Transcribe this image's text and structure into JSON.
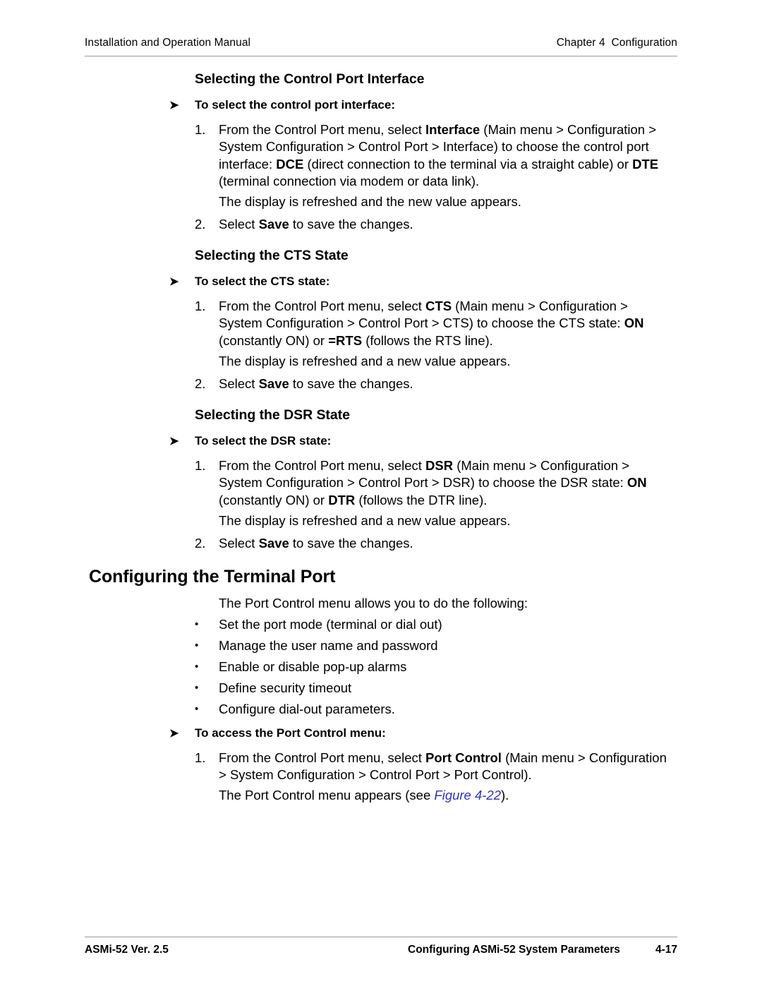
{
  "header": {
    "left": "Installation and Operation Manual",
    "right": "Chapter 4  Configuration"
  },
  "footer": {
    "left": "ASMi-52 Ver. 2.5",
    "center": "Configuring ASMi-52 System Parameters",
    "page": "4-17"
  },
  "icons": {
    "arrow_bullet": "➤",
    "round_bullet": "•"
  },
  "colors": {
    "text": "#000000",
    "rule": "#9a9a9a",
    "cross_reference": "#3333bb"
  },
  "sections": {
    "control_port_interface": {
      "heading": "Selecting the Control Port Interface",
      "procedure_title": "To select the control port interface:",
      "step1_num": "1.",
      "step1_a": "From the Control Port menu, select ",
      "step1_b": "Interface",
      "step1_c": " (Main menu > Configuration > System Configuration > Control Port > Interface) to choose the control port interface: ",
      "step1_d": "DCE",
      "step1_e": " (direct connection to the terminal via a straight cable) or ",
      "step1_f": "DTE",
      "step1_g": " (terminal connection via modem or data link).",
      "result": "The display is refreshed and the new value appears.",
      "step2_num": "2.",
      "step2_a": "Select ",
      "step2_b": "Save",
      "step2_c": " to save the changes."
    },
    "cts_state": {
      "heading": "Selecting the CTS State",
      "procedure_title": "To select the CTS state:",
      "step1_num": "1.",
      "step1_a": "From the Control Port menu, select ",
      "step1_b": "CTS",
      "step1_c": " (Main menu > Configuration > System Configuration > Control Port > CTS) to choose the CTS state: ",
      "step1_d": "ON",
      "step1_e": " (constantly ON) or ",
      "step1_f": "=RTS",
      "step1_g": " (follows the RTS line).",
      "result": "The display is refreshed and a new value appears.",
      "step2_num": "2.",
      "step2_a": "Select ",
      "step2_b": "Save",
      "step2_c": " to save the changes."
    },
    "dsr_state": {
      "heading": "Selecting the DSR State",
      "procedure_title": "To select the DSR state:",
      "step1_num": "1.",
      "step1_a": "From the Control Port menu, select ",
      "step1_b": "DSR",
      "step1_c": " (Main menu > Configuration > System Configuration > Control Port > DSR) to choose the DSR state: ",
      "step1_d": "ON",
      "step1_e": " (constantly ON) or ",
      "step1_f": "DTR",
      "step1_g": " (follows the DTR line).",
      "result": "The display is refreshed and a new value appears.",
      "step2_num": "2.",
      "step2_a": "Select ",
      "step2_b": "Save",
      "step2_c": " to save the changes."
    },
    "terminal_port": {
      "heading": "Configuring the Terminal Port",
      "intro": "The Port Control menu allows you to do the following:",
      "bullets": [
        "Set the port mode (terminal or dial out)",
        "Manage the user name and password",
        "Enable or disable pop-up alarms",
        "Define security timeout",
        "Configure dial-out parameters."
      ],
      "procedure_title": "To access the Port Control menu:",
      "step1_num": "1.",
      "step1_a": "From the Control Port menu, select ",
      "step1_b": "Port Control",
      "step1_c": " (Main menu > Configuration > System Configuration > Control Port > Port Control).",
      "result_a": "The Port Control menu appears (see ",
      "result_xref": "Figure 4-22",
      "result_b": ")."
    }
  }
}
